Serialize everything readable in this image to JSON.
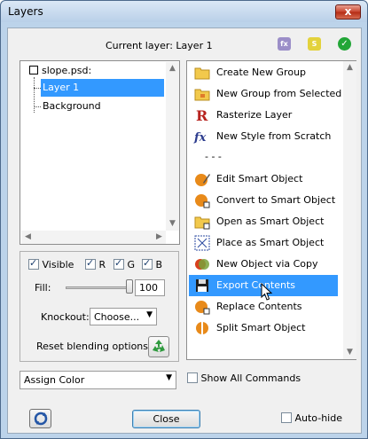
{
  "window": {
    "title": "Layers",
    "close_glyph": "x"
  },
  "header": {
    "current_layer_label": "Current layer: Layer 1",
    "icons": [
      {
        "name": "fx-icon",
        "text": "fx",
        "color": "#9b8ec8"
      },
      {
        "name": "script-icon",
        "text": "S",
        "color": "#e3d23c"
      },
      {
        "name": "checkmark-icon",
        "text": "✓",
        "color": "#22a637"
      }
    ]
  },
  "tree": {
    "root_label": "slope.psd:",
    "items": [
      {
        "label": "Layer 1",
        "selected": true
      },
      {
        "label": "Background",
        "selected": false
      }
    ]
  },
  "options": {
    "visible_label": "Visible",
    "r_label": "R",
    "g_label": "G",
    "b_label": "B",
    "visible_checked": true,
    "r_checked": true,
    "g_checked": true,
    "b_checked": true,
    "fill_label": "Fill:",
    "fill_value": "100",
    "fill_fraction": 1.0,
    "knockout_label": "Knockout:",
    "knockout_value": "Choose...",
    "reset_label": "Reset blending options:"
  },
  "commands": [
    {
      "label": "Create New Group",
      "icon": "folder-icon",
      "selected": false
    },
    {
      "label": "New Group from Selected",
      "icon": "folder-group-icon",
      "selected": false
    },
    {
      "label": "Rasterize Layer",
      "icon": "rasterize-icon",
      "selected": false
    },
    {
      "label": "New Style from Scratch",
      "icon": "fx-style-icon",
      "selected": false
    },
    {
      "separator": "- - -"
    },
    {
      "label": "Edit Smart Object",
      "icon": "smart-object-edit-icon",
      "selected": false
    },
    {
      "label": "Convert to Smart Object",
      "icon": "smart-object-convert-icon",
      "selected": false
    },
    {
      "label": "Open as Smart Object",
      "icon": "folder-smart-icon",
      "selected": false
    },
    {
      "label": "Place as Smart Object",
      "icon": "place-icon",
      "selected": false
    },
    {
      "label": "New Object via Copy",
      "icon": "smart-object-copy-icon",
      "selected": false
    },
    {
      "label": "Export Contents",
      "icon": "floppy-disk-icon",
      "selected": true
    },
    {
      "label": "Replace Contents",
      "icon": "smart-object-replace-icon",
      "selected": false
    },
    {
      "label": "Split Smart Object",
      "icon": "smart-object-split-icon",
      "selected": false
    }
  ],
  "bottom": {
    "assign_color_value": "Assign Color",
    "show_all_label": "Show All Commands",
    "show_all_checked": false,
    "close_label": "Close",
    "autohide_label": "Auto-hide",
    "autohide_checked": false
  },
  "colors": {
    "selection": "#3399ff",
    "window_frame": "#bcd3ea"
  }
}
